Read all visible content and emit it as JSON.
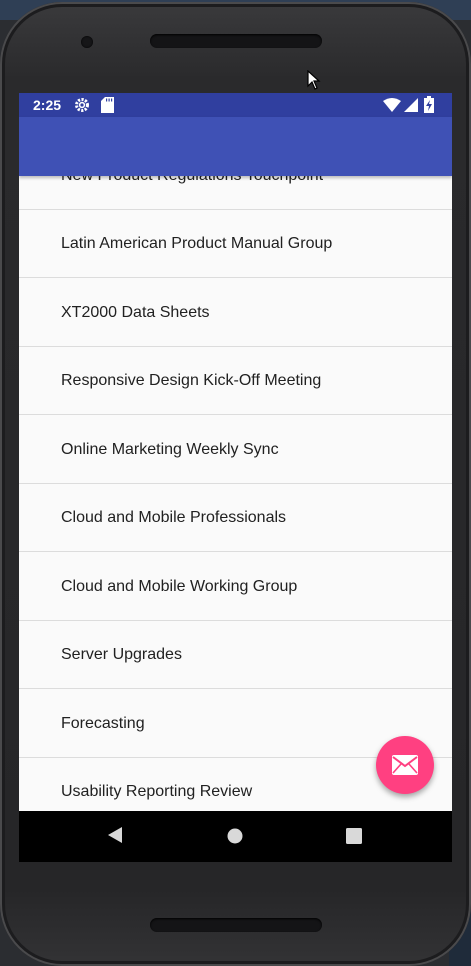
{
  "status_bar": {
    "time": "2:25",
    "icons": [
      "settings-icon",
      "sd-card-icon",
      "wifi-icon",
      "cell-signal-icon",
      "battery-charging-icon"
    ]
  },
  "app_bar": {
    "color": "#3f51b5"
  },
  "list": {
    "items": [
      "New Product Regulations Touchpoint",
      "Latin American Product Manual Group",
      "XT2000 Data Sheets",
      "Responsive Design Kick-Off Meeting",
      "Online Marketing Weekly Sync",
      "Cloud and Mobile Professionals",
      "Cloud and Mobile Working Group",
      "Server Upgrades",
      "Forecasting",
      "Usability Reporting Review"
    ]
  },
  "fab": {
    "icon": "mail-icon",
    "color": "#ff4081"
  },
  "nav_bar": {
    "icons": [
      "back-icon",
      "home-icon",
      "recents-icon"
    ]
  },
  "colors": {
    "status_bar": "#303f9f",
    "primary": "#3f51b5",
    "accent": "#ff4081"
  }
}
